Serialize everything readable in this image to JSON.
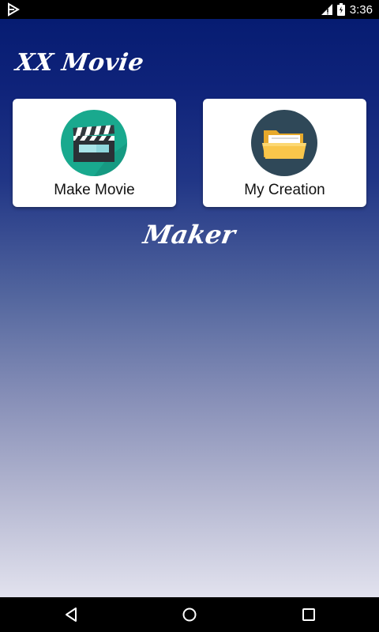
{
  "status_bar": {
    "time": "3:36",
    "left_icon": "play-store-notification-icon",
    "signal_icon": "signal-icon",
    "battery_icon": "battery-icon"
  },
  "app": {
    "title": "XX Movie",
    "subtitle": "Maker"
  },
  "cards": [
    {
      "label": "Make Movie",
      "icon": "clapperboard-icon",
      "icon_bg": "#19a98e"
    },
    {
      "label": "My Creation",
      "icon": "folder-icon",
      "icon_bg": "#2f4858"
    }
  ],
  "nav_bar": {
    "back_icon": "back-icon",
    "home_icon": "home-icon",
    "recent_icon": "recent-apps-icon"
  },
  "colors": {
    "gradient_top": "#061c72",
    "gradient_bottom": "#e2e2ee",
    "card_bg": "#ffffff",
    "folder_yellow": "#f9c64b"
  }
}
